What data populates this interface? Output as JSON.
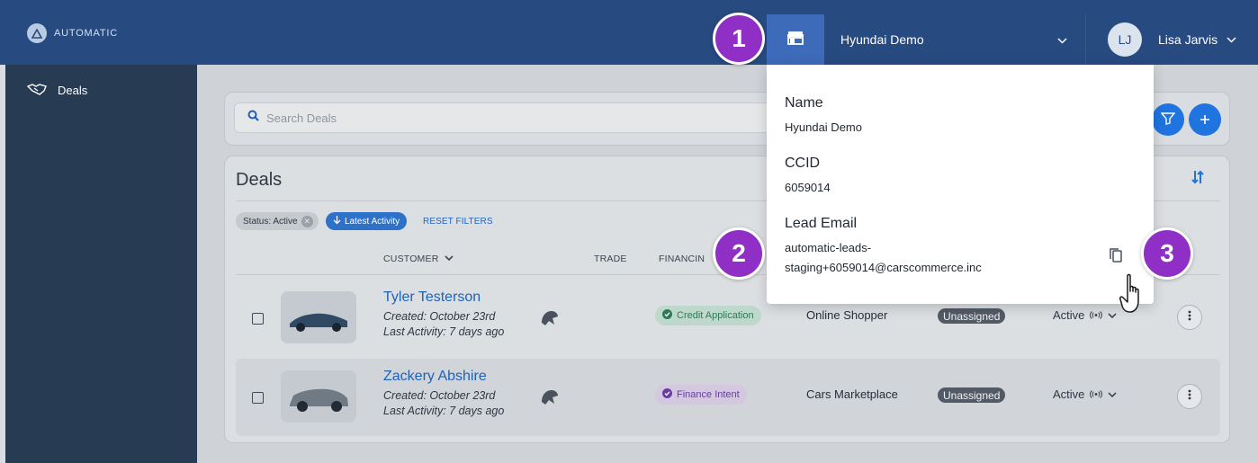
{
  "app": {
    "logo_text": "AUTOMATIC"
  },
  "header": {
    "dealer_name": "Hyundai Demo",
    "user_initials": "LJ",
    "user_name": "Lisa Jarvis"
  },
  "sidebar": {
    "items": [
      {
        "label": "Deals",
        "icon": "handshake-icon"
      }
    ]
  },
  "search": {
    "placeholder": "Search Deals"
  },
  "deals": {
    "title": "Deals",
    "filters": {
      "status_chip": "Status: Active",
      "activity_chip": "Latest Activity",
      "reset": "RESET FILTERS"
    },
    "columns": [
      "CUSTOMER",
      "TRADE",
      "FINANCIN"
    ],
    "rows": [
      {
        "name": "Tyler Testerson",
        "created": "Created: October 23rd",
        "last_activity": "Last Activity: 7 days ago",
        "status_badge": "Credit Application",
        "source": "Online Shopper",
        "assignment": "Unassigned",
        "state": "Active"
      },
      {
        "name": "Zackery Abshire",
        "created": "Created: October 23rd",
        "last_activity": "Last Activity: 7 days ago",
        "status_badge": "Finance Intent",
        "source": "Cars Marketplace",
        "assignment": "Unassigned",
        "state": "Active"
      }
    ]
  },
  "popover": {
    "name_label": "Name",
    "name_value": "Hyundai Demo",
    "ccid_label": "CCID",
    "ccid_value": "6059014",
    "email_label": "Lead Email",
    "email_line1": "automatic-leads-",
    "email_line2": "staging+6059014@carscommerce.inc"
  },
  "callouts": [
    "1",
    "2",
    "3"
  ],
  "colors": {
    "header": "#274a80",
    "sidebar": "#273b53",
    "accent": "#1f74e0",
    "callout": "#8f2fc6"
  }
}
